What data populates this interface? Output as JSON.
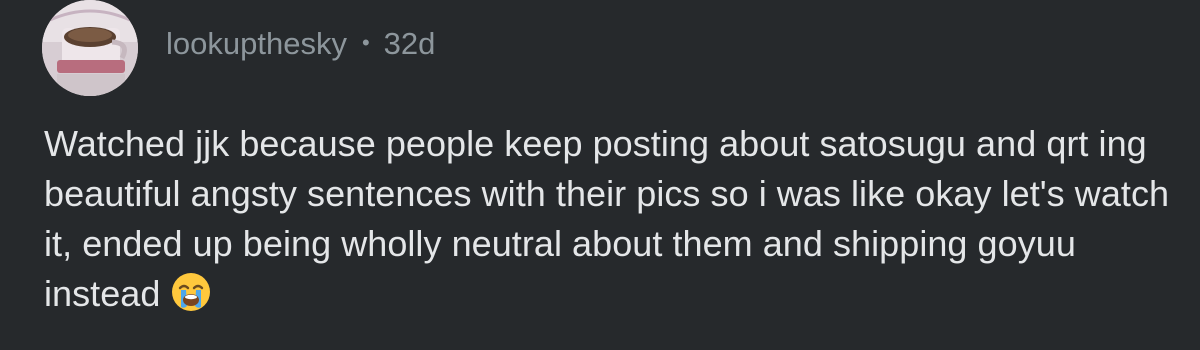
{
  "comment": {
    "author": {
      "username": "lookupthesky",
      "avatar_icon": "profile-avatar-coffee-cup"
    },
    "separator": "•",
    "timestamp": "32d",
    "body": "Watched jjk because people keep posting about satosugu and qrt ing beautiful angsty sentences with their pics so i was like okay let's watch it, ended up being wholly neutral about them and shipping goyuu instead",
    "emoji": "loudly-crying-face-icon"
  },
  "colors": {
    "background": "#26292c",
    "meta_text": "#8d969c",
    "body_text": "#e4e6e8",
    "avatar_background": "#d8cfd4",
    "emoji_face": "#ffc83d",
    "emoji_tears": "#4ea7ec"
  }
}
